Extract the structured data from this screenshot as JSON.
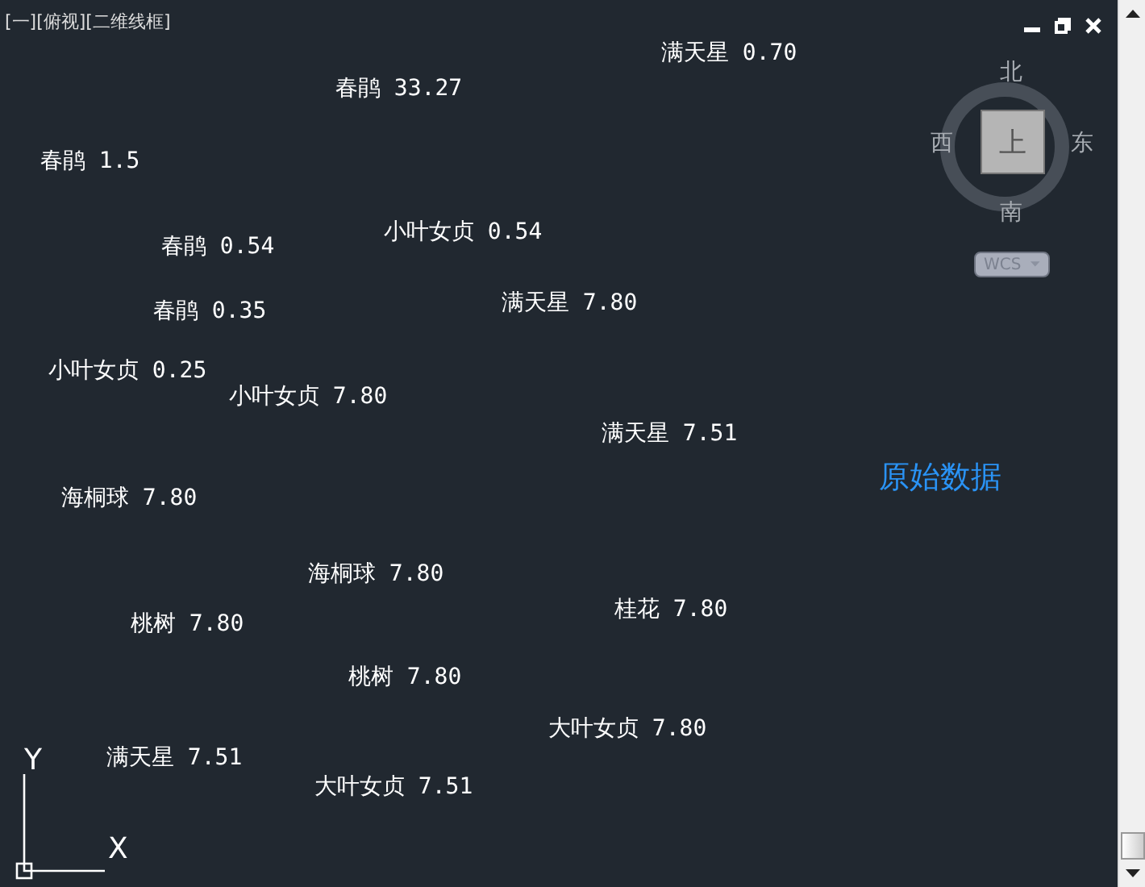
{
  "viewport": {
    "label": "[一][俯视][二维线框]"
  },
  "labels": [
    {
      "text": "满天星 0.70"
    },
    {
      "text": "春鹃 33.27"
    },
    {
      "text": "春鹃 1.5"
    },
    {
      "text": "春鹃 0.54"
    },
    {
      "text": "小叶女贞 0.54"
    },
    {
      "text": "春鹃 0.35"
    },
    {
      "text": "满天星 7.80"
    },
    {
      "text": "小叶女贞 0.25"
    },
    {
      "text": "小叶女贞 7.80"
    },
    {
      "text": "满天星 7.51"
    },
    {
      "text": "海桐球 7.80"
    },
    {
      "text": "海桐球 7.80"
    },
    {
      "text": "桂花 7.80"
    },
    {
      "text": "桃树 7.80"
    },
    {
      "text": "桃树 7.80"
    },
    {
      "text": "大叶女贞 7.80"
    },
    {
      "text": "满天星 7.51"
    },
    {
      "text": "大叶女贞 7.51"
    }
  ],
  "heading": {
    "text": "原始数据"
  },
  "viewcube": {
    "north": "北",
    "south": "南",
    "west": "西",
    "east": "东",
    "face": "上",
    "coordinate_system": "WCS"
  },
  "ucs": {
    "x": "X",
    "y": "Y"
  }
}
